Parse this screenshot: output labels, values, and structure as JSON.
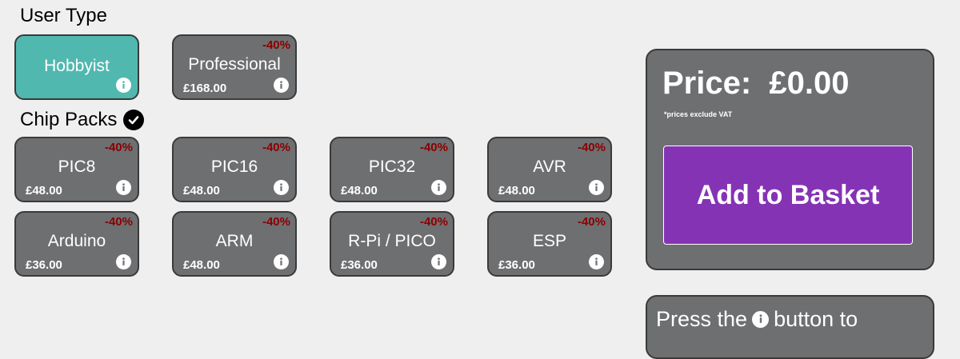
{
  "user_type": {
    "heading": "User Type",
    "options": [
      {
        "label": "Hobbyist",
        "selected": true
      },
      {
        "label": "Professional",
        "discount": "-40%",
        "price": "£168.00",
        "selected": false
      }
    ]
  },
  "chip_packs": {
    "heading": "Chip Packs",
    "items": [
      {
        "label": "PIC8",
        "discount": "-40%",
        "price": "£48.00"
      },
      {
        "label": "PIC16",
        "discount": "-40%",
        "price": "£48.00"
      },
      {
        "label": "PIC32",
        "discount": "-40%",
        "price": "£48.00"
      },
      {
        "label": "AVR",
        "discount": "-40%",
        "price": "£48.00"
      },
      {
        "label": "Arduino",
        "discount": "-40%",
        "price": "£36.00"
      },
      {
        "label": "ARM",
        "discount": "-40%",
        "price": "£48.00"
      },
      {
        "label": "R-Pi / PICO",
        "discount": "-40%",
        "price": "£36.00"
      },
      {
        "label": "ESP",
        "discount": "-40%",
        "price": "£36.00"
      }
    ]
  },
  "price_panel": {
    "title": "Price:  £0.00",
    "vat_note": "*prices exclude VAT",
    "button_label": "Add to Basket"
  },
  "help": {
    "text_before": "Press the",
    "text_after": "button to"
  },
  "colors": {
    "tile": "#6e6f71",
    "selected_tile": "#51b8b0",
    "discount": "#8a0000",
    "basket_button": "#8533b5",
    "background": "#efefef"
  },
  "icons": {
    "info": "info-icon",
    "check": "check-circle-icon"
  }
}
